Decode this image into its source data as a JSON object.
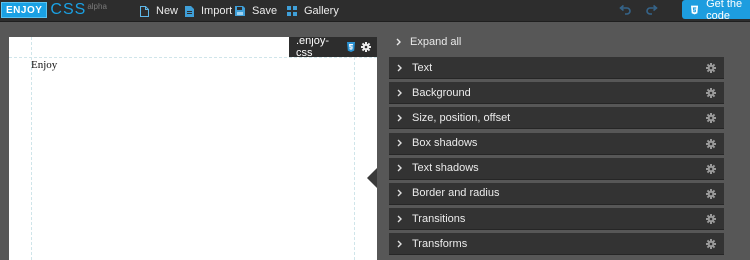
{
  "brand": {
    "enjoy": "ENJOY",
    "css": "CSS",
    "tag": "alpha"
  },
  "toolbar": {
    "new_label": "New",
    "import_label": "Import",
    "save_label": "Save",
    "gallery_label": "Gallery",
    "get_code_label": "Get the code"
  },
  "preview": {
    "sample_text": "Enjoy",
    "selector_tab": ".enjoy-css"
  },
  "panel": {
    "expand_all_label": "Expand all",
    "sections": [
      {
        "label": "Text"
      },
      {
        "label": "Background"
      },
      {
        "label": "Size, position, offset"
      },
      {
        "label": "Box shadows"
      },
      {
        "label": "Text shadows"
      },
      {
        "label": "Border and radius"
      },
      {
        "label": "Transitions"
      },
      {
        "label": "Transforms"
      }
    ]
  },
  "colors": {
    "accent": "#1d9ddf",
    "topbar": "#2d2d2d",
    "panel_bg": "#575757",
    "section_bg": "#333333"
  },
  "icons": [
    "new-file-icon",
    "import-file-icon",
    "save-icon",
    "gallery-icon",
    "undo-icon",
    "redo-icon",
    "css3-icon",
    "gear-icon",
    "chevron-right-icon"
  ]
}
